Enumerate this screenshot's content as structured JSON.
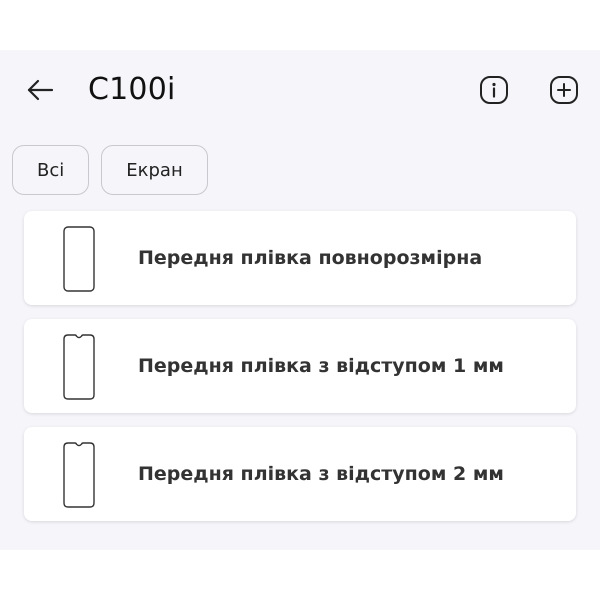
{
  "header": {
    "title": "C100i",
    "icons": {
      "back": "arrow-left-icon",
      "info": "info-icon",
      "add": "add-icon"
    }
  },
  "filters": [
    {
      "label": "Всі"
    },
    {
      "label": "Екран"
    }
  ],
  "items": [
    {
      "label": "Передня плівка повнорозмірна",
      "icon": "phone-outline-icon"
    },
    {
      "label": "Передня плівка з відступом 1 мм",
      "icon": "phone-notch-icon"
    },
    {
      "label": "Передня плівка з відступом 2 мм",
      "icon": "phone-notch-icon"
    }
  ],
  "colors": {
    "background": "#f6f5fa",
    "card": "#ffffff",
    "text": "#333333",
    "chip_border": "#c9c8ce"
  }
}
